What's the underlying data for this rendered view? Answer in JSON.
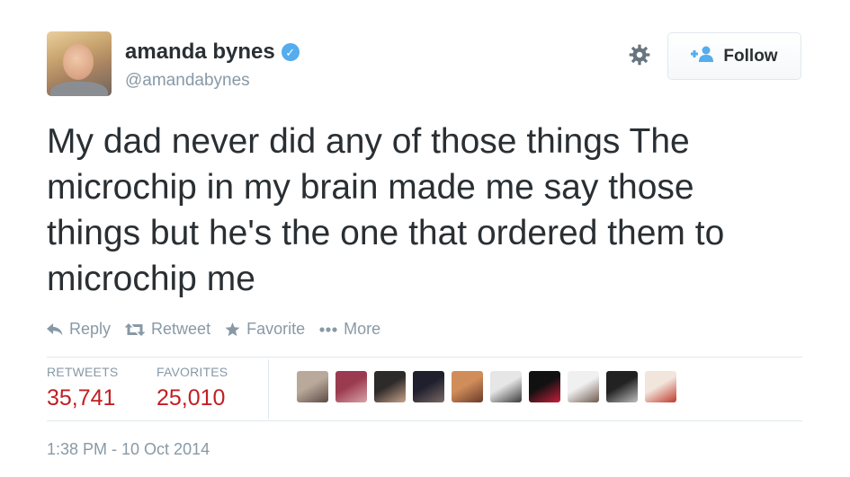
{
  "user": {
    "display_name": "amanda bynes",
    "verified_icon": "✓",
    "handle": "@amandabynes"
  },
  "follow_button": {
    "icon": "+person-icon",
    "label": "Follow"
  },
  "tweet": {
    "lines": [
      "My dad never did any of those things The",
      "microchip in my brain made me say those",
      "things but he's the one that ordered them to",
      "microchip me"
    ]
  },
  "actions": {
    "reply": "Reply",
    "retweet": "Retweet",
    "favorite": "Favorite",
    "more": "More"
  },
  "stats": {
    "retweets_label": "RETWEETS",
    "retweets_value": "35,741",
    "favorites_label": "FAVORITES",
    "favorites_value": "25,010"
  },
  "favoriters": [
    {
      "colors": [
        "#b9a99a",
        "#5c4b46"
      ]
    },
    {
      "colors": [
        "#9b3b4f",
        "#d9a3a9"
      ]
    },
    {
      "colors": [
        "#2d2a2a",
        "#c9a38a"
      ]
    },
    {
      "colors": [
        "#1f1f2e",
        "#7a6a66"
      ]
    },
    {
      "colors": [
        "#d08d5a",
        "#6b3a2a"
      ]
    },
    {
      "colors": [
        "#e6e6e6",
        "#3a3a3a"
      ]
    },
    {
      "colors": [
        "#111111",
        "#c81e3c"
      ]
    },
    {
      "colors": [
        "#f0f0f0",
        "#6f5a4e"
      ]
    },
    {
      "colors": [
        "#222222",
        "#bfbfbf"
      ]
    },
    {
      "colors": [
        "#f2e6dc",
        "#c0392b"
      ]
    }
  ],
  "timestamp": "1:38 PM - 10 Oct 2014",
  "colors": {
    "accent_blue": "#55acee",
    "count_red": "#c11f24",
    "muted_gray": "#8899a6"
  }
}
